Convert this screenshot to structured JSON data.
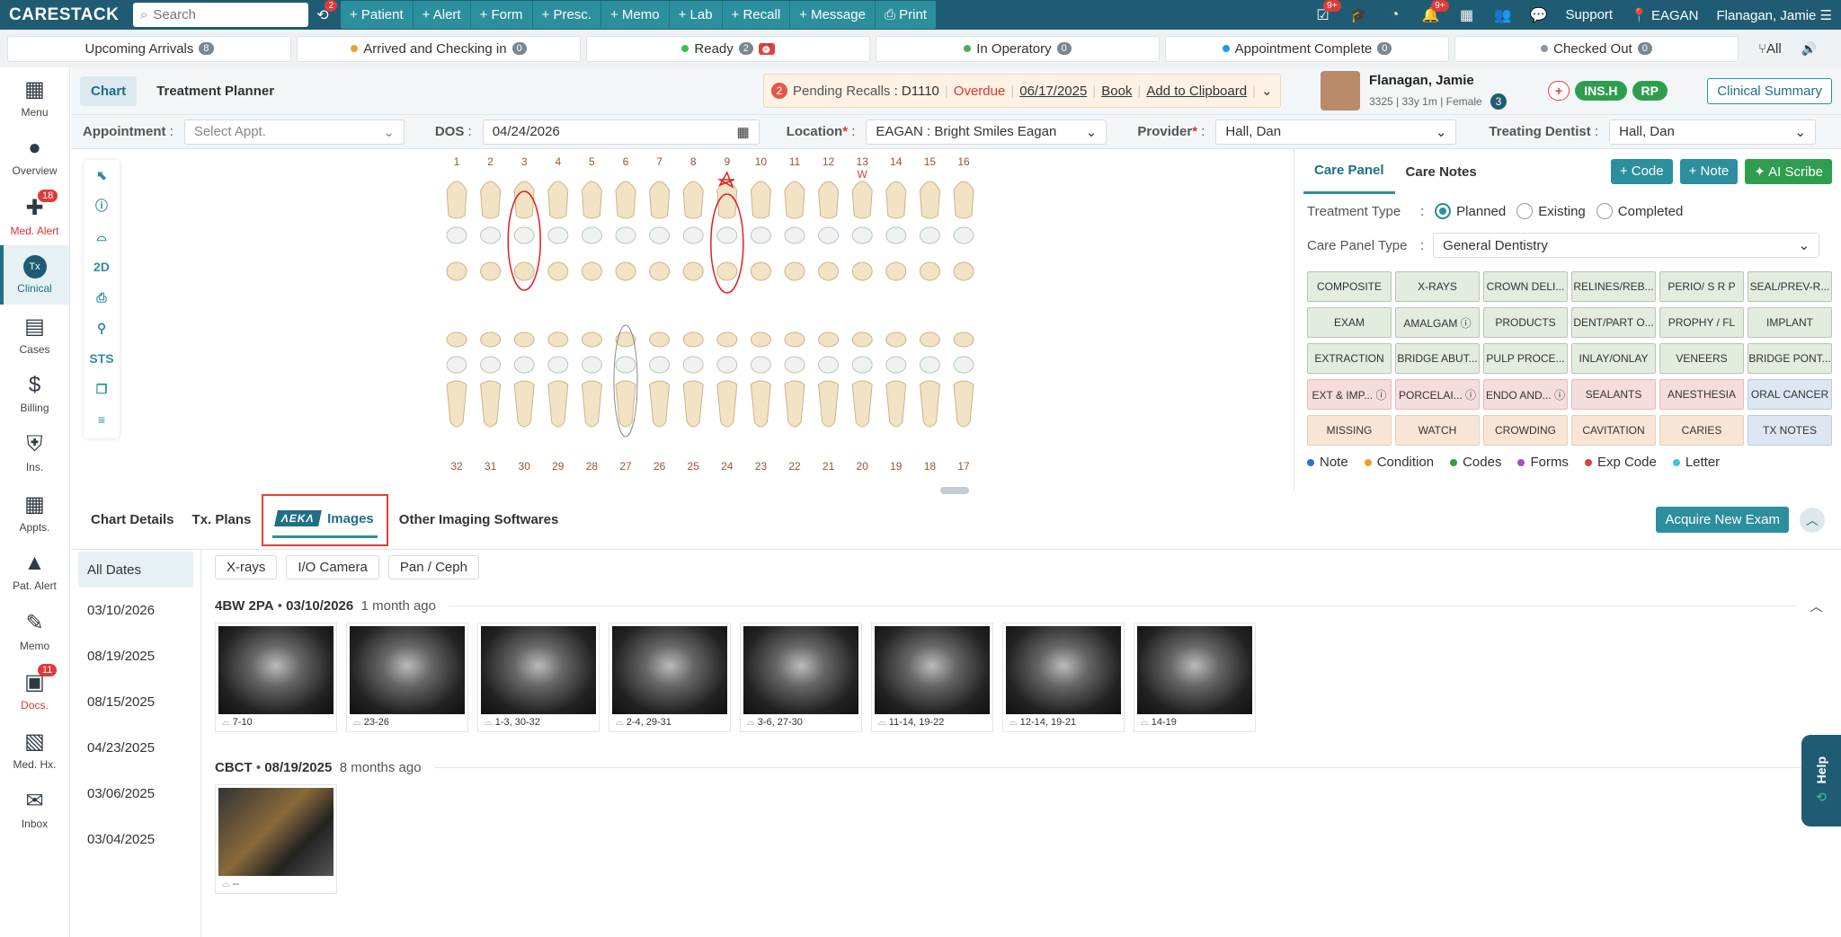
{
  "app": {
    "logo": "CARESTACK",
    "search_placeholder": "Search"
  },
  "top": {
    "actions": [
      "+ Patient",
      "+ Alert",
      "+ Form",
      "+ Presc.",
      "+ Memo",
      "+ Lab",
      "+ Recall",
      "+ Message",
      "⎙ Print"
    ],
    "badge_history": "2",
    "badge_a": "9+",
    "badge_b": "9+",
    "support": "Support",
    "location": "EAGAN",
    "user": "Flanagan, Jamie"
  },
  "status": [
    {
      "label": "Upcoming Arrivals",
      "count": "8",
      "color": ""
    },
    {
      "label": "Arrived and Checking in",
      "count": "0",
      "color": "#f0a030"
    },
    {
      "label": "Ready",
      "count": "2",
      "color": "#3cc04a"
    },
    {
      "label": "In Operatory",
      "count": "0",
      "color": "#4caf50"
    },
    {
      "label": "Appointment Complete",
      "count": "0",
      "color": "#2196f3"
    },
    {
      "label": "Checked Out",
      "count": "0",
      "color": "#8a969e"
    }
  ],
  "status_all": "All",
  "sidebar": [
    {
      "label": "Menu",
      "icon": "grid-icon",
      "badge": ""
    },
    {
      "label": "Overview",
      "icon": "person-icon",
      "badge": ""
    },
    {
      "label": "Med. Alert",
      "icon": "med-alert-icon",
      "badge": "18"
    },
    {
      "label": "Clinical",
      "icon": "clinical-icon",
      "badge": ""
    },
    {
      "label": "Cases",
      "icon": "cases-icon",
      "badge": ""
    },
    {
      "label": "Billing",
      "icon": "billing-icon",
      "badge": ""
    },
    {
      "label": "Ins.",
      "icon": "insurance-icon",
      "badge": ""
    },
    {
      "label": "Appts.",
      "icon": "calendar-icon",
      "badge": ""
    },
    {
      "label": "Pat. Alert",
      "icon": "alert-icon",
      "badge": ""
    },
    {
      "label": "Memo",
      "icon": "memo-icon",
      "badge": ""
    },
    {
      "label": "Docs.",
      "icon": "docs-icon",
      "badge": "11"
    },
    {
      "label": "Med. Hx.",
      "icon": "medhx-icon",
      "badge": ""
    },
    {
      "label": "Inbox",
      "icon": "inbox-icon",
      "badge": ""
    }
  ],
  "chart_tabs": [
    "Chart",
    "Treatment Planner"
  ],
  "recall": {
    "count": "2",
    "label": "Pending Recalls",
    "code": ": D1110",
    "status": "Overdue",
    "date": "06/17/2025",
    "book": "Book",
    "clip": "Add to Clipboard"
  },
  "patient": {
    "name": "Flanagan, Jamie",
    "id": "3325",
    "age": "33y 1m",
    "sex": "Female",
    "count": "3",
    "ins": "INS.H",
    "rp": "RP",
    "plus": "+"
  },
  "clinical_summary": "Clinical Summary",
  "filters": {
    "appointment_label": "Appointment",
    "appointment_placeholder": "Select Appt.",
    "dos_label": "DOS",
    "dos": "04/24/2026",
    "location_label": "Location",
    "location": "EAGAN : Bright Smiles Eagan",
    "provider_label": "Provider",
    "provider": "Hall, Dan",
    "treating_label": "Treating Dentist",
    "treating": "Hall, Dan"
  },
  "tools": [
    "⬉",
    "ⓘ",
    "⌓",
    "2D",
    "⎙",
    "⚲",
    "STS",
    "❐",
    "≡"
  ],
  "teeth_upper": [
    "1",
    "2",
    "3",
    "4",
    "5",
    "6",
    "7",
    "8",
    "9",
    "10",
    "11",
    "12",
    "13",
    "14",
    "15",
    "16"
  ],
  "teeth_lower": [
    "32",
    "31",
    "30",
    "29",
    "28",
    "27",
    "26",
    "25",
    "24",
    "23",
    "22",
    "21",
    "20",
    "19",
    "18",
    "17"
  ],
  "tooth_13_mark": "W",
  "care": {
    "tab_panel": "Care Panel",
    "tab_notes": "Care Notes",
    "btn_code": "+ Code",
    "btn_note": "+ Note",
    "btn_ai": "✦ AI Scribe",
    "treatment_type_label": "Treatment Type",
    "types": [
      "Planned",
      "Existing",
      "Completed"
    ],
    "panel_type_label": "Care Panel Type",
    "panel_type": "General Dentistry",
    "codes": [
      {
        "t": "COMPOSITE",
        "c": "g"
      },
      {
        "t": "X-RAYS",
        "c": "g"
      },
      {
        "t": "CROWN DELI...",
        "c": "g"
      },
      {
        "t": "RELINES/REB...",
        "c": "g"
      },
      {
        "t": "PERIO/ S R P",
        "c": "g"
      },
      {
        "t": "SEAL/PREV-R...",
        "c": "g"
      },
      {
        "t": "EXAM",
        "c": "g"
      },
      {
        "t": "AMALGAM ⓘ",
        "c": "g"
      },
      {
        "t": "PRODUCTS",
        "c": "g"
      },
      {
        "t": "DENT/PART O...",
        "c": "g"
      },
      {
        "t": "PROPHY / FL",
        "c": "g"
      },
      {
        "t": "IMPLANT",
        "c": "g"
      },
      {
        "t": "EXTRACTION",
        "c": "g"
      },
      {
        "t": "BRIDGE ABUT...",
        "c": "g"
      },
      {
        "t": "PULP PROCE...",
        "c": "g"
      },
      {
        "t": "INLAY/ONLAY",
        "c": "g"
      },
      {
        "t": "VENEERS",
        "c": "g"
      },
      {
        "t": "BRIDGE PONT...",
        "c": "g"
      },
      {
        "t": "EXT & IMP... ⓘ",
        "c": "p"
      },
      {
        "t": "PORCELAI... ⓘ",
        "c": "p"
      },
      {
        "t": "ENDO AND... ⓘ",
        "c": "p"
      },
      {
        "t": "SEALANTS",
        "c": "p"
      },
      {
        "t": "ANESTHESIA",
        "c": "p"
      },
      {
        "t": "ORAL CANCER",
        "c": "b"
      },
      {
        "t": "MISSING",
        "c": "o"
      },
      {
        "t": "WATCH",
        "c": "o"
      },
      {
        "t": "CROWDING",
        "c": "o"
      },
      {
        "t": "CAVITATION",
        "c": "o"
      },
      {
        "t": "CARIES",
        "c": "o"
      },
      {
        "t": "TX NOTES",
        "c": "b"
      }
    ],
    "legend": [
      {
        "t": "Note",
        "c": "#2f6fd6"
      },
      {
        "t": "Condition",
        "c": "#f0a030"
      },
      {
        "t": "Codes",
        "c": "#2e9e4e"
      },
      {
        "t": "Forms",
        "c": "#9b4fd6"
      },
      {
        "t": "Exp Code",
        "c": "#e04040"
      },
      {
        "t": "Letter",
        "c": "#3cc8d8"
      }
    ]
  },
  "imaging": {
    "tabs": [
      "Chart Details",
      "Tx. Plans",
      "Images",
      "Other Imaging Softwares"
    ],
    "aeka": "ΛEKΛ",
    "acquire": "Acquire New Exam",
    "dates": [
      "All Dates",
      "03/10/2026",
      "08/19/2025",
      "08/15/2025",
      "04/23/2025",
      "03/06/2025",
      "03/04/2025"
    ],
    "chips": [
      "X-rays",
      "I/O Camera",
      "Pan / Ceph"
    ],
    "group1": {
      "type": "4BW 2PA",
      "date": "03/10/2026",
      "ago": "1 month ago",
      "images": [
        "7-10",
        "23-26",
        "1-3, 30-32",
        "2-4, 29-31",
        "3-6, 27-30",
        "11-14, 19-22",
        "12-14, 19-21",
        "14-19"
      ]
    },
    "group2": {
      "type": "CBCT",
      "date": "08/19/2025",
      "ago": "8 months ago",
      "images": [
        "--"
      ]
    }
  },
  "help": "Help"
}
